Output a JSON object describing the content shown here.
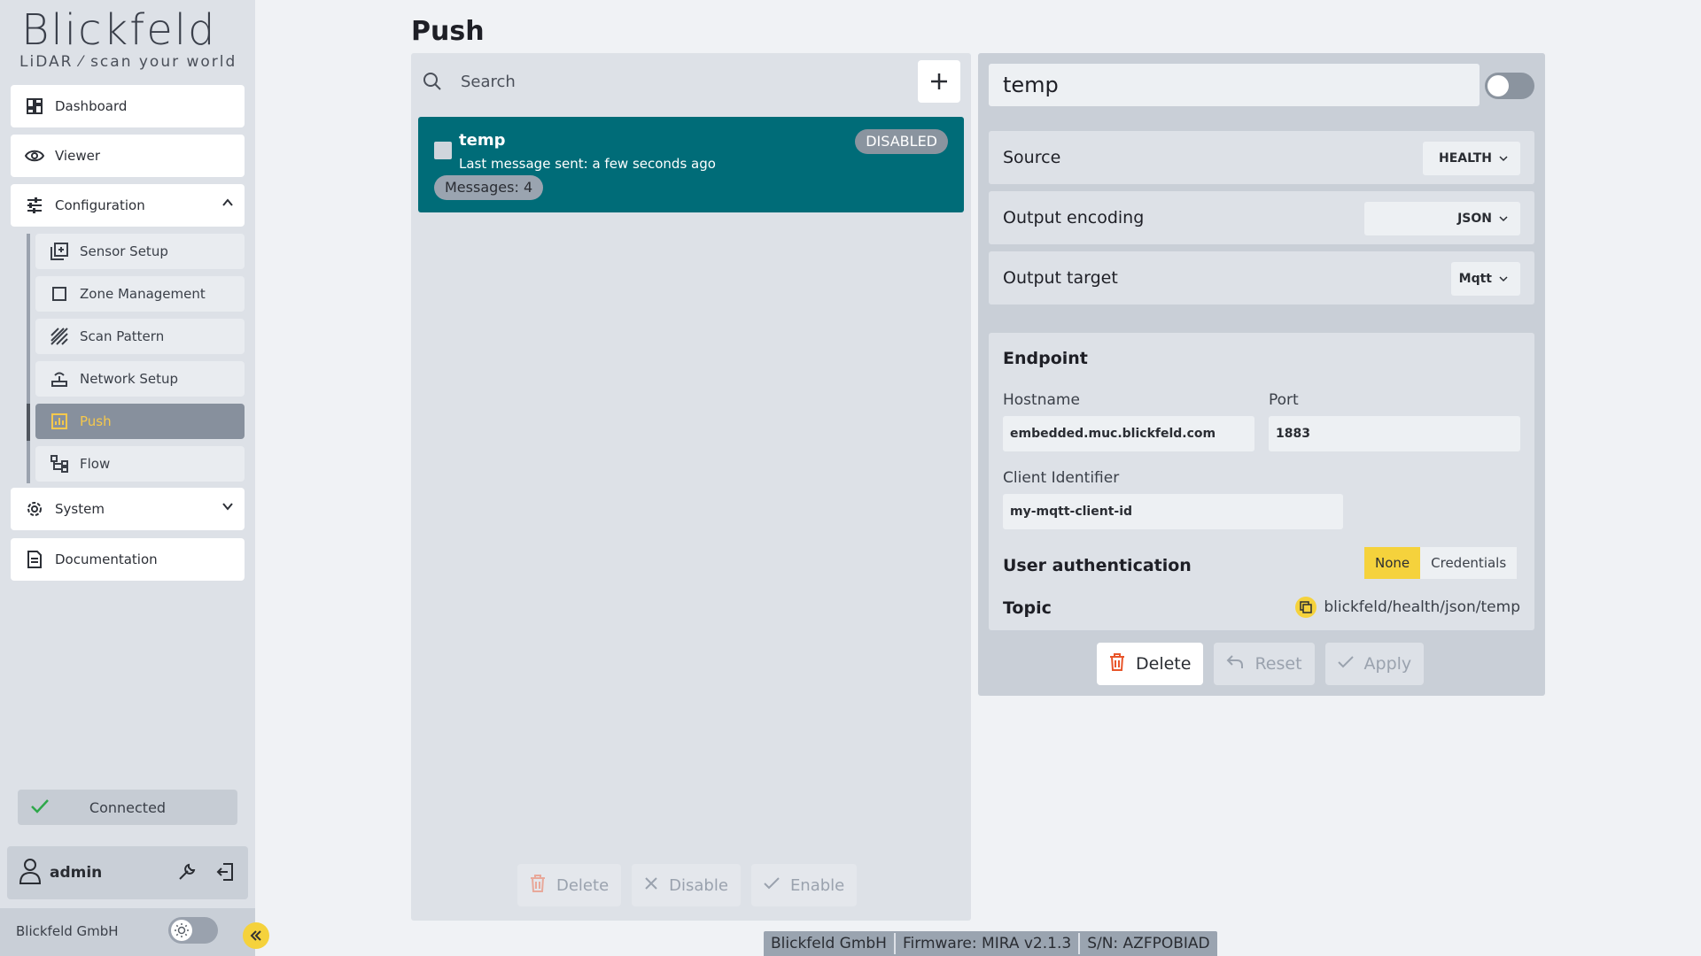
{
  "brand": {
    "logo_text": "Blickfeld",
    "tagline": "LiDAR ⁄ scan your world",
    "company": "Blickfeld GmbH"
  },
  "nav": {
    "dashboard": "Dashboard",
    "viewer": "Viewer",
    "configuration": "Configuration",
    "sub": {
      "sensor_setup": "Sensor Setup",
      "zone_management": "Zone Management",
      "scan_pattern": "Scan Pattern",
      "network_setup": "Network Setup",
      "push": "Push",
      "flow": "Flow"
    },
    "system": "System",
    "documentation": "Documentation"
  },
  "connection": {
    "status": "Connected"
  },
  "user": {
    "name": "admin"
  },
  "page": {
    "title": "Push"
  },
  "list": {
    "search_placeholder": "Search",
    "items": [
      {
        "name": "temp",
        "last_message": "Last message sent: a few seconds ago",
        "messages": "Messages: 4",
        "status": "DISABLED"
      }
    ],
    "actions": {
      "delete": "Delete",
      "disable": "Disable",
      "enable": "Enable"
    }
  },
  "detail": {
    "name": "temp",
    "enabled": false,
    "source_label": "Source",
    "source_value": "HEALTH",
    "encoding_label": "Output encoding",
    "encoding_value": "JSON",
    "target_label": "Output target",
    "target_value": "Mqtt",
    "endpoint_title": "Endpoint",
    "hostname_label": "Hostname",
    "hostname_value": "embedded.muc.blickfeld.com",
    "port_label": "Port",
    "port_value": "1883",
    "client_id_label": "Client Identifier",
    "client_id_value": "my-mqtt-client-id",
    "auth_label": "User authentication",
    "auth_options": [
      "None",
      "Credentials"
    ],
    "auth_selected": "None",
    "topic_label": "Topic",
    "topic_value": "blickfeld/health/json/temp",
    "actions": {
      "delete": "Delete",
      "reset": "Reset",
      "apply": "Apply"
    }
  },
  "footer": {
    "company": "Blickfeld GmbH",
    "firmware": "Firmware: MIRA v2.1.3",
    "serial": "S/N: AZFPOBIAD"
  },
  "colors": {
    "accent": "#f5d23c",
    "selected_card": "#006c78",
    "delete_icon": "#e8552a"
  }
}
